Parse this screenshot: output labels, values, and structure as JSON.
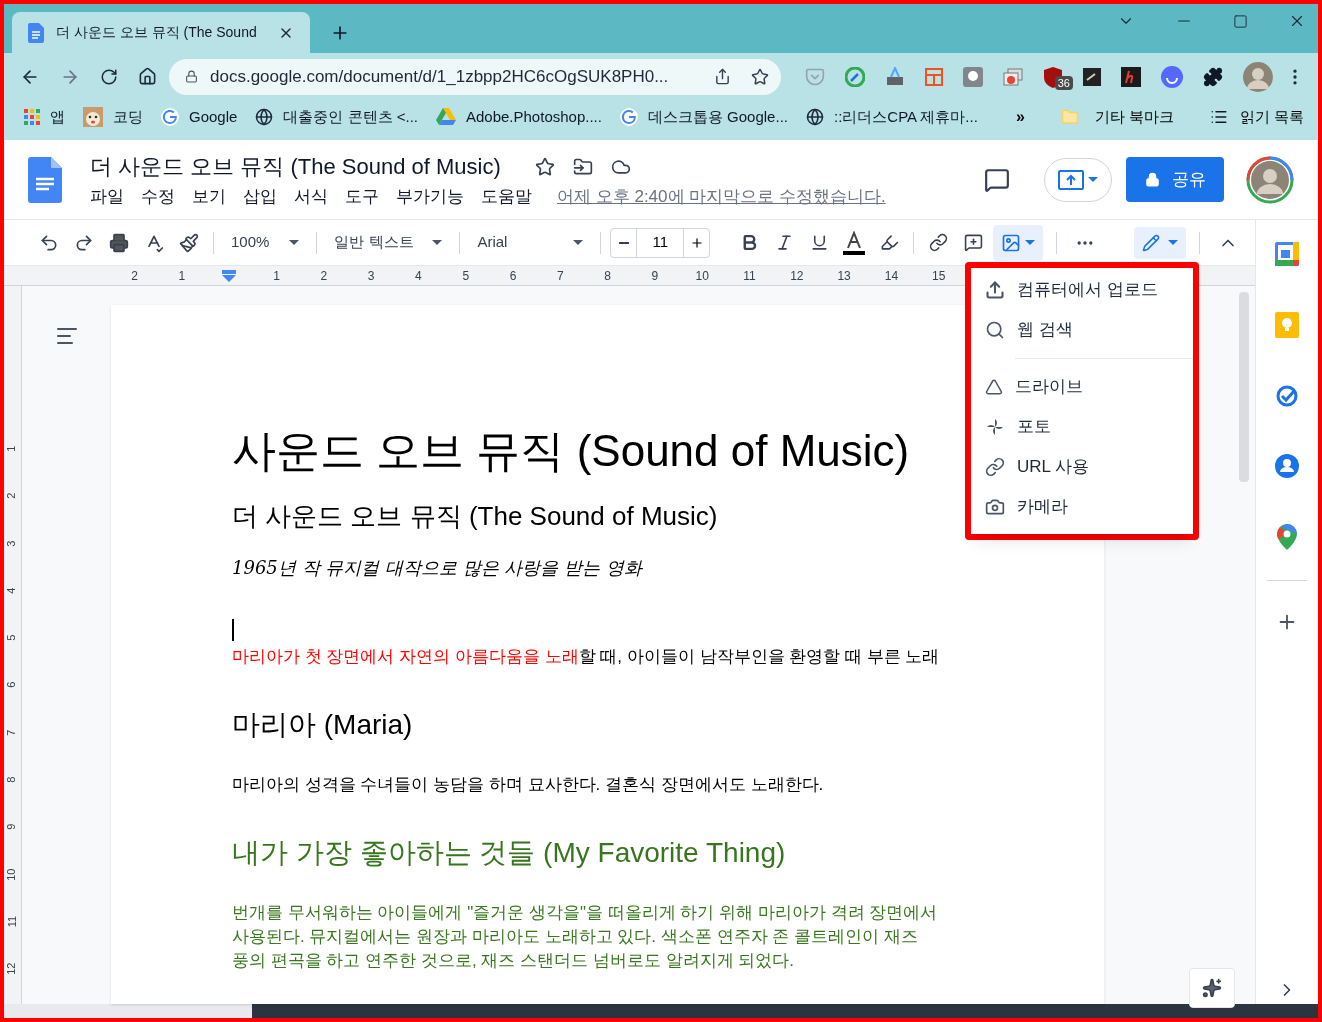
{
  "browser": {
    "tab": {
      "title": "더 사운드 오브 뮤직 (The Sound",
      "selected": true
    },
    "address": {
      "url": "docs.google.com/document/d/1_1zbpp2HC6cOgSUK8PH0..."
    },
    "extension_badge": "36",
    "bookmarks": [
      {
        "label": "앱",
        "kind": "apps"
      },
      {
        "label": "코딩"
      },
      {
        "label": "Google",
        "kind": "google"
      },
      {
        "label": "대출중인 콘텐츠 <...",
        "kind": "globe"
      },
      {
        "label": "Adobe.Photoshop....",
        "kind": "drive"
      },
      {
        "label": "데스크톱용 Google...",
        "kind": "google"
      },
      {
        "label": "::리더스CPA 제휴마...",
        "kind": "globe"
      }
    ],
    "overflow": "»",
    "other_bookmarks": "기타 북마크",
    "reading_list": "읽기 목록"
  },
  "docs": {
    "title": "더 사운드 오브 뮤직 (The Sound of Music)",
    "menus": [
      "파일",
      "수정",
      "보기",
      "삽입",
      "서식",
      "도구",
      "부가기능",
      "도움말"
    ],
    "last_edit": "어제 오후 2:40에 마지막으로 수정했습니다.",
    "share": "공유",
    "toolbar": {
      "zoom": "100%",
      "style": "일반 텍스트",
      "font": "Arial",
      "size": "11",
      "image_menu_open": true
    },
    "ruler": {
      "left_marks": [
        "2",
        "1"
      ],
      "right_marks": [
        "1",
        "2",
        "3",
        "4",
        "5",
        "6",
        "7",
        "8",
        "9",
        "10",
        "11",
        "12",
        "13",
        "14",
        "15"
      ]
    },
    "vertical_ruler": [
      "1",
      "2",
      "3",
      "4",
      "5",
      "6",
      "7",
      "8",
      "9",
      "10",
      "11",
      "12"
    ]
  },
  "image_menu": {
    "groups": [
      [
        {
          "label": "컴퓨터에서 업로드",
          "kind": "upload"
        },
        {
          "label": "웹 검색",
          "kind": "search"
        }
      ],
      [
        {
          "label": "드라이브",
          "kind": "drive"
        },
        {
          "label": "포토",
          "kind": "photos"
        },
        {
          "label": "URL 사용",
          "kind": "link"
        },
        {
          "label": "카메라",
          "kind": "camera"
        }
      ]
    ]
  },
  "document": {
    "blocks": [
      {
        "kind": "title",
        "runs": [
          {
            "text": "사운드 오브 뮤직 (Sound of Music)",
            "color": "#000000"
          }
        ]
      },
      {
        "kind": "subtitle",
        "runs": [
          {
            "text": "더 사운드 오브 뮤직 (The Sound of Music)",
            "color": "#000000"
          }
        ]
      },
      {
        "kind": "handwriting",
        "runs": [
          {
            "text": "1965년 작 뮤지컬 대작으로 많은 사랑을 받는 영화",
            "color": "#000000"
          }
        ]
      },
      {
        "kind": "cursor"
      },
      {
        "kind": "body",
        "runs": [
          {
            "text": "마리아가 첫 장면에서 자연의 아름다움을 노래",
            "color": "#ff0000"
          },
          {
            "text": "할 때, 아이들이 남작부인을 환영할 때 부른 노래",
            "color": "#000000"
          }
        ]
      },
      {
        "kind": "heading",
        "runs": [
          {
            "text": "마리아 (Maria)",
            "color": "#000000"
          }
        ]
      },
      {
        "kind": "body",
        "runs": [
          {
            "text": "마리아의 성격을 수녀들이 농담을 하며 묘사한다. 결혼식 장면에서도 노래한다.",
            "color": "#000000"
          }
        ]
      },
      {
        "kind": "heading",
        "runs": [
          {
            "text": "내가 가장 좋아하는 것들 (My Favorite Thing)",
            "color": "#38761d"
          }
        ]
      },
      {
        "kind": "body",
        "runs": [
          {
            "text": "번개를 무서워하는 아이들에게 \"즐거운 생각을\"을 떠올리게 하기 위해 마리아가 격려 장면에서 사용된다. 뮤지컬에서는 원장과 마리아도 노래하고 있다. 색소폰 연주자 존 콜트레인이 재즈 풍의 편곡을 하고 연주한 것으로, 재즈 스탠더드 넘버로도 알려지게 되었다.",
            "color": "#38761d"
          }
        ]
      }
    ]
  }
}
